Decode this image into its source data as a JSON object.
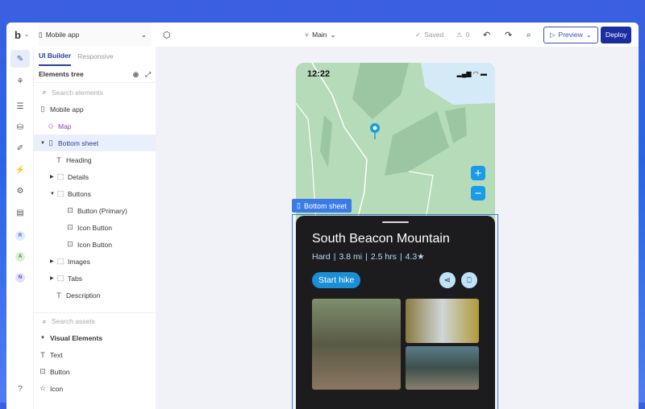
{
  "topbar": {
    "logo": "b",
    "project": "Mobile app",
    "branch": "Main",
    "saved": "Saved",
    "warnings": "0",
    "preview": "Preview",
    "deploy": "Deploy"
  },
  "rail": {
    "avatars": [
      "R",
      "A",
      "N"
    ]
  },
  "panel": {
    "tabs": [
      "UI Builder",
      "Responsive"
    ],
    "tree_title": "Elements tree",
    "search_placeholder": "Search elements",
    "tree": [
      {
        "label": "Mobile app"
      },
      {
        "label": "Map"
      },
      {
        "label": "Bottom sheet"
      },
      {
        "label": "Heading"
      },
      {
        "label": "Details"
      },
      {
        "label": "Buttons"
      },
      {
        "label": "Button (Primary)"
      },
      {
        "label": "Icon Button"
      },
      {
        "label": "Icon Button"
      },
      {
        "label": "Images"
      },
      {
        "label": "Tabs"
      },
      {
        "label": "Description"
      }
    ],
    "assets_placeholder": "Search assets",
    "assets_section": "Visual Elements",
    "assets": [
      "Text",
      "Button",
      "Icon"
    ]
  },
  "phone": {
    "time": "12:22",
    "selection_label": "Bottom sheet",
    "title": "South Beacon Mountain",
    "difficulty": "Hard",
    "distance": "3.8 mi",
    "duration": "2.5 hrs",
    "rating": "4.3★",
    "start": "Start hike"
  },
  "colors": {
    "accent": "#3b7be8",
    "deploy": "#1b2ea0",
    "sheet": "#1c1c1e",
    "map": "#b5dbb8"
  }
}
